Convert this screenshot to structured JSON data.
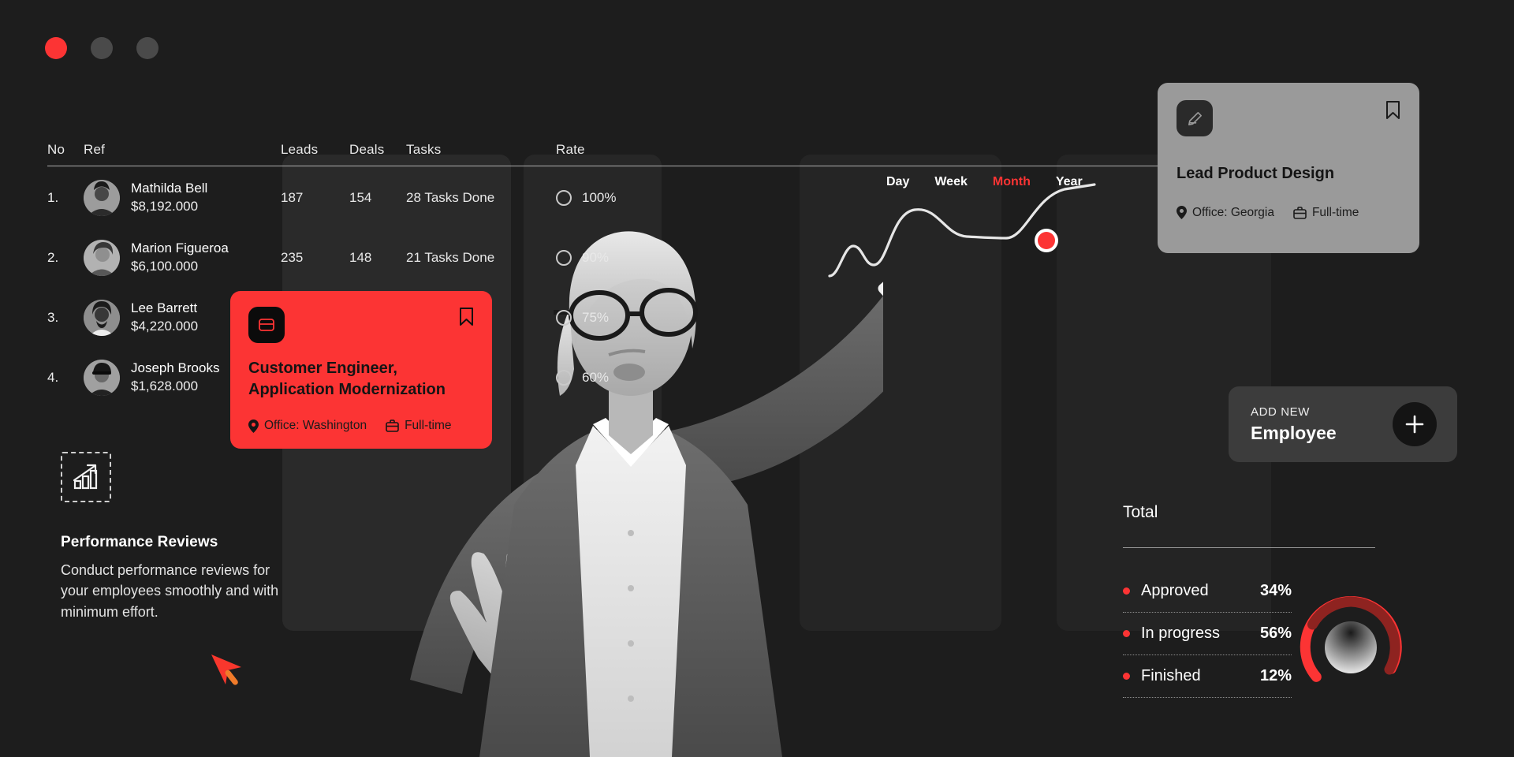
{
  "window": {
    "dots": [
      "close-red",
      "minimize-grey",
      "maximize-grey"
    ]
  },
  "table": {
    "headers": {
      "no": "No",
      "ref": "Ref",
      "leads": "Leads",
      "deals": "Deals",
      "tasks": "Tasks",
      "rate": "Rate"
    },
    "rows": [
      {
        "no": "1.",
        "name": "Mathilda Bell",
        "money": "$8,192.000",
        "leads": "187",
        "deals": "154",
        "tasks": "28 Tasks Done",
        "rate": "100%"
      },
      {
        "no": "2.",
        "name": "Marion Figueroa",
        "money": "$6,100.000",
        "leads": "235",
        "deals": "148",
        "tasks": "21 Tasks Done",
        "rate": "90%"
      },
      {
        "no": "3.",
        "name": "Lee Barrett",
        "money": "$4,220.000",
        "leads": "",
        "deals": "",
        "tasks": "",
        "rate": "75%"
      },
      {
        "no": "4.",
        "name": "Joseph Brooks",
        "money": "$1,628.000",
        "leads": "",
        "deals": "",
        "tasks": "",
        "rate": "60%"
      }
    ]
  },
  "performance": {
    "icon": "bar-chart-growth-icon",
    "title": "Performance Reviews",
    "body": "Conduct performance reviews for your employees smoothly and with minimum effort."
  },
  "job_card_red": {
    "icon": "card-wallet-icon",
    "bookmark_icon": "bookmark-icon",
    "title": "Customer Engineer, Application Modernization",
    "location_icon": "location-pin-icon",
    "location": "Office: Washington",
    "type_icon": "briefcase-icon",
    "type": "Full-time",
    "accent": "#fc3434"
  },
  "job_card_grey": {
    "icon": "edit-pencil-icon",
    "bookmark_icon": "bookmark-icon",
    "title": "Lead Product Design",
    "location_icon": "location-pin-icon",
    "location": "Office: Georgia",
    "type_icon": "briefcase-icon",
    "type": "Full-time",
    "background": "#9a9a9a"
  },
  "range_tabs": {
    "items": [
      "Day",
      "Week",
      "Month",
      "Year"
    ],
    "active": "Month",
    "active_color": "#fc3434"
  },
  "add_new": {
    "eyebrow": "ADD NEW",
    "label": "Employee",
    "plus_icon": "plus-icon"
  },
  "total": {
    "title": "Total",
    "legend": [
      {
        "label": "Approved",
        "value": "34%"
      },
      {
        "label": "In progress",
        "value": "56%"
      },
      {
        "label": "Finished",
        "value": "12%"
      }
    ]
  },
  "cursor": {
    "icon": "mouse-pointer-arrow",
    "color": "#f8372d"
  },
  "chart_data": {
    "type": "line",
    "title": "",
    "xlabel": "",
    "ylabel": "",
    "x": [
      0,
      1,
      2,
      3,
      4,
      5,
      6,
      7,
      8,
      9,
      10
    ],
    "values": [
      8,
      30,
      42,
      22,
      18,
      58,
      74,
      62,
      52,
      52,
      96
    ],
    "highlight_index": 9,
    "highlight_color": "#fc3434",
    "line_color": "#e6e6e6",
    "grid": false,
    "legend_position": "none"
  },
  "donut_chart": {
    "type": "pie",
    "categories": [
      "Approved",
      "In progress",
      "Finished"
    ],
    "values": [
      34,
      56,
      12
    ],
    "colors": [
      "#8e2320",
      "#fc3434",
      "#8e2320"
    ],
    "title": "Total"
  }
}
